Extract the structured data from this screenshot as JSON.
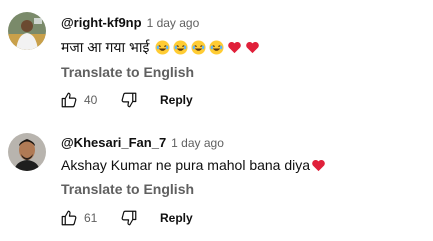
{
  "comments": [
    {
      "author": "@right-kf9np",
      "time": "1 day ago",
      "text": "मजा आ गया भाई",
      "emojis": [
        "laughing-face",
        "laughing-face",
        "laughing-face",
        "laughing-face",
        "red-heart",
        "red-heart"
      ],
      "translate_label": "Translate to English",
      "likes": "40",
      "reply_label": "Reply"
    },
    {
      "author": "@Khesari_Fan_7",
      "time": "1 day ago",
      "text": "Akshay Kumar ne pura mahol bana diya",
      "emojis": [
        "red-heart"
      ],
      "translate_label": "Translate to English",
      "likes": "61",
      "reply_label": "Reply"
    }
  ],
  "colors": {
    "text_primary": "#0f0f0f",
    "text_secondary": "#606060",
    "heart": "#e0203a",
    "laugh_face": "#ffcc33"
  }
}
